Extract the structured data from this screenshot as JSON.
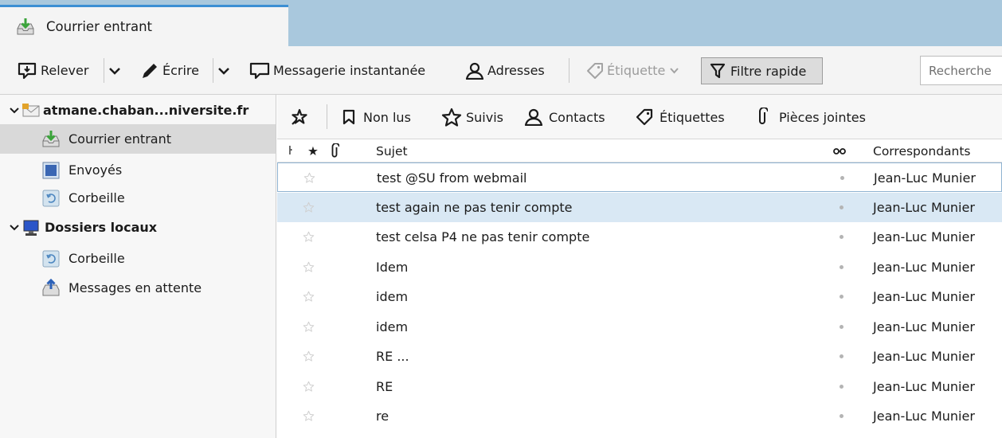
{
  "colors": {
    "tab_strip": "#a9c8dd",
    "active_tab_border": "#3c8fd3",
    "selected_row": "#d9e8f4",
    "selected_folder": "#d9d9d9",
    "toolbar_bg": "#f4f4f4"
  },
  "tab": {
    "label": "Courrier entrant",
    "icon": "inbox-icon"
  },
  "toolbar": {
    "get_mail": "Relever",
    "write": "Écrire",
    "chat": "Messagerie instantanée",
    "address_book": "Adresses",
    "tag": "Étiquette",
    "quick_filter": "Filtre rapide",
    "search_placeholder": "Recherche"
  },
  "sidebar": {
    "account": "atmane.chaban...niversite.fr",
    "account_folders": [
      "Courrier entrant",
      "Envoyés",
      "Corbeille"
    ],
    "local": "Dossiers locaux",
    "local_folders": [
      "Corbeille",
      "Messages en attente"
    ],
    "selected": "Courrier entrant"
  },
  "quick_filter": {
    "unread": "Non lus",
    "starred": "Suivis",
    "contacts": "Contacts",
    "tags": "Étiquettes",
    "attachments": "Pièces jointes"
  },
  "columns": {
    "thread": "ŀ",
    "star": "★",
    "subject": "Sujet",
    "correspondents": "Correspondants"
  },
  "messages": [
    {
      "subject": "test @SU from webmail",
      "correspondent": "Jean-Luc Munier",
      "starred": false,
      "focused": true,
      "selected": false
    },
    {
      "subject": "test  again ne pas tenir compte",
      "correspondent": "Jean-Luc Munier",
      "starred": false,
      "focused": false,
      "selected": true
    },
    {
      "subject": "test celsa P4 ne pas tenir compte",
      "correspondent": "Jean-Luc Munier",
      "starred": false,
      "focused": false,
      "selected": false
    },
    {
      "subject": "Idem",
      "correspondent": "Jean-Luc Munier",
      "starred": false,
      "focused": false,
      "selected": false
    },
    {
      "subject": "idem",
      "correspondent": "Jean-Luc Munier",
      "starred": false,
      "focused": false,
      "selected": false
    },
    {
      "subject": "idem",
      "correspondent": "Jean-Luc Munier",
      "starred": false,
      "focused": false,
      "selected": false
    },
    {
      "subject": "RE ...",
      "correspondent": "Jean-Luc Munier",
      "starred": false,
      "focused": false,
      "selected": false
    },
    {
      "subject": "RE",
      "correspondent": "Jean-Luc Munier",
      "starred": false,
      "focused": false,
      "selected": false
    },
    {
      "subject": "re",
      "correspondent": "Jean-Luc Munier",
      "starred": false,
      "focused": false,
      "selected": false
    }
  ]
}
